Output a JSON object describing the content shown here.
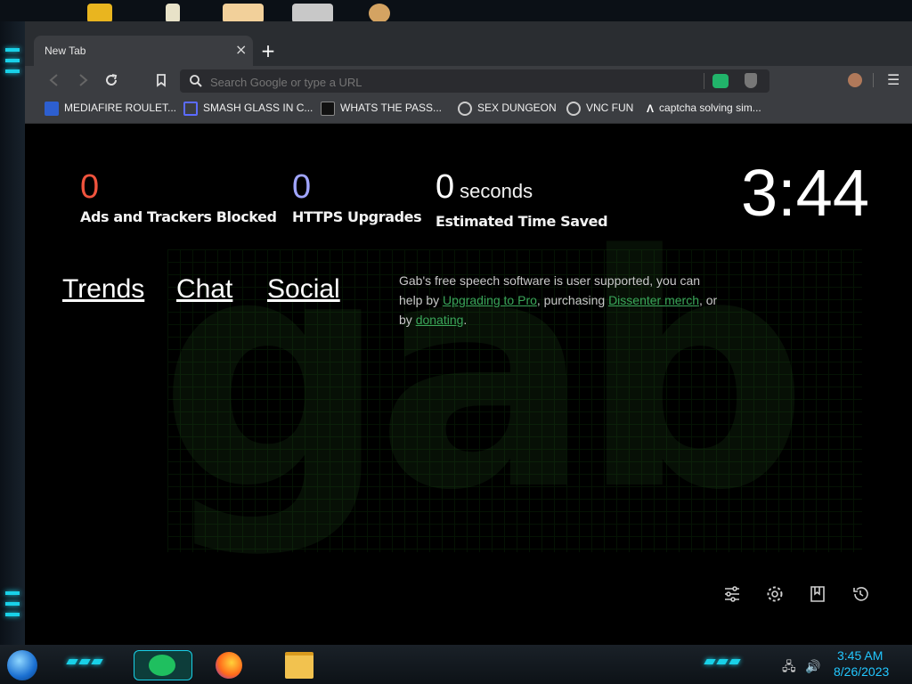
{
  "browser": {
    "tab": {
      "title": "New Tab"
    },
    "omnibox": {
      "placeholder": "Search Google or type a URL"
    },
    "bookmarks": [
      {
        "label": "MEDIAFIRE ROULET...",
        "icon": "mediafire-icon"
      },
      {
        "label": "SMASH GLASS IN C...",
        "icon": "bracket-icon"
      },
      {
        "label": "WHATS THE PASS...",
        "icon": "lock-icon"
      },
      {
        "label": "SEX DUNGEON",
        "icon": "gear-icon"
      },
      {
        "label": "VNC FUN",
        "icon": "gear-icon"
      },
      {
        "label": "captcha solving sim...",
        "icon": "lambda-icon"
      }
    ]
  },
  "newtab": {
    "stats": [
      {
        "value": "0",
        "label": "Ads and Trackers Blocked",
        "color": "#f0533d"
      },
      {
        "value": "0",
        "label": "HTTPS Upgrades",
        "color": "#a0a5ff"
      },
      {
        "value": "0",
        "unit": "seconds",
        "label": "Estimated Time Saved",
        "color": "#ffffff"
      }
    ],
    "clock": "3:44",
    "links": [
      "Trends",
      "Chat",
      "Social"
    ],
    "support": {
      "t1": "Gab's free speech software is user supported, you can help by ",
      "link1": "Upgrading to Pro",
      "t2": ", purchasing ",
      "link2": "Dissenter merch",
      "t3": ", or by ",
      "link3": "donating",
      "t4": "."
    }
  },
  "taskbar": {
    "time": "3:45 AM",
    "date": "8/26/2023"
  }
}
